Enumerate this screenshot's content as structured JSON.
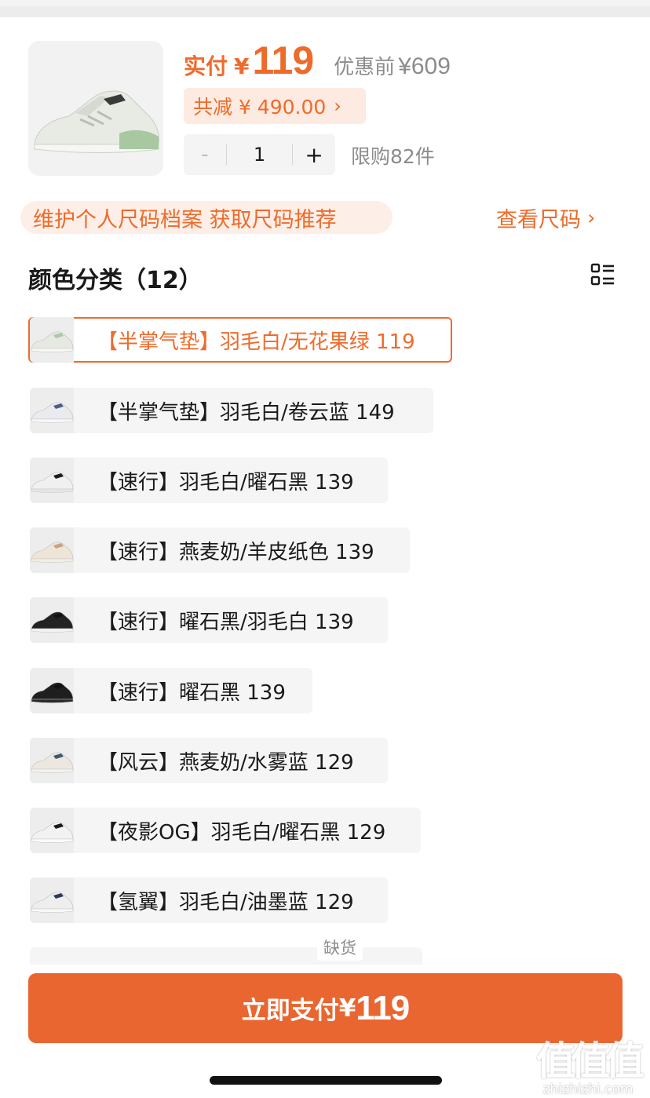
{
  "header": {
    "price_label": "实付",
    "currency": "¥",
    "price": "119",
    "original_label": "优惠前",
    "original_price": "¥609",
    "discount": "共减 ¥ 490.00",
    "quantity": "1",
    "minus": "-",
    "plus": "+",
    "limit": "限购82件"
  },
  "size": {
    "profile_prompt": "维护个人尺码档案 获取尺码推荐",
    "view_size": "查看尺码"
  },
  "colors": {
    "title": "颜色分类（12）",
    "items": [
      {
        "label": "【半掌气垫】羽毛白/无花果绿 119",
        "selected": true,
        "shoe": "#e6e9e1",
        "accent": "#a9c9a3",
        "sole": "#f7f7f3"
      },
      {
        "label": "【半掌气垫】羽毛白/卷云蓝 149",
        "selected": false,
        "shoe": "#e9ebee",
        "accent": "#4a5f86",
        "sole": "#f7f7f7"
      },
      {
        "label": "【速行】羽毛白/曜石黑 139",
        "selected": false,
        "shoe": "#f0f0f0",
        "accent": "#1c1c1c",
        "sole": "#e5e5e5"
      },
      {
        "label": "【速行】燕麦奶/羊皮纸色 139",
        "selected": false,
        "shoe": "#eee5d8",
        "accent": "#c9a37f",
        "sole": "#f3ede3"
      },
      {
        "label": "【速行】曜石黑/羽毛白 139",
        "selected": false,
        "shoe": "#222222",
        "accent": "#111111",
        "sole": "#f2f2f2"
      },
      {
        "label": "【速行】曜石黑 139",
        "selected": false,
        "shoe": "#1e1e1e",
        "accent": "#111111",
        "sole": "#2a2a2a"
      },
      {
        "label": "【风云】燕麦奶/水雾蓝 129",
        "selected": false,
        "shoe": "#ece8e0",
        "accent": "#3d5874",
        "sole": "#f4f2ee"
      },
      {
        "label": "【夜影OG】羽毛白/曜石黑 129",
        "selected": false,
        "shoe": "#f2f2f2",
        "accent": "#1a1a1a",
        "sole": "#fafafa"
      },
      {
        "label": "【氢翼】羽毛白/油墨蓝 129",
        "selected": false,
        "shoe": "#eeeeee",
        "accent": "#2f3c55",
        "sole": "#f8f8f8"
      }
    ],
    "stock_badge": "缺货"
  },
  "footer": {
    "pay_label": "立即支付",
    "pay_currency": "¥",
    "pay_amount": "119"
  },
  "watermark": {
    "logo": "值值值",
    "url": "zhizhizhi.com"
  },
  "colors_theme": {
    "accent": "#ee6b2b",
    "button": "#ea6630"
  }
}
